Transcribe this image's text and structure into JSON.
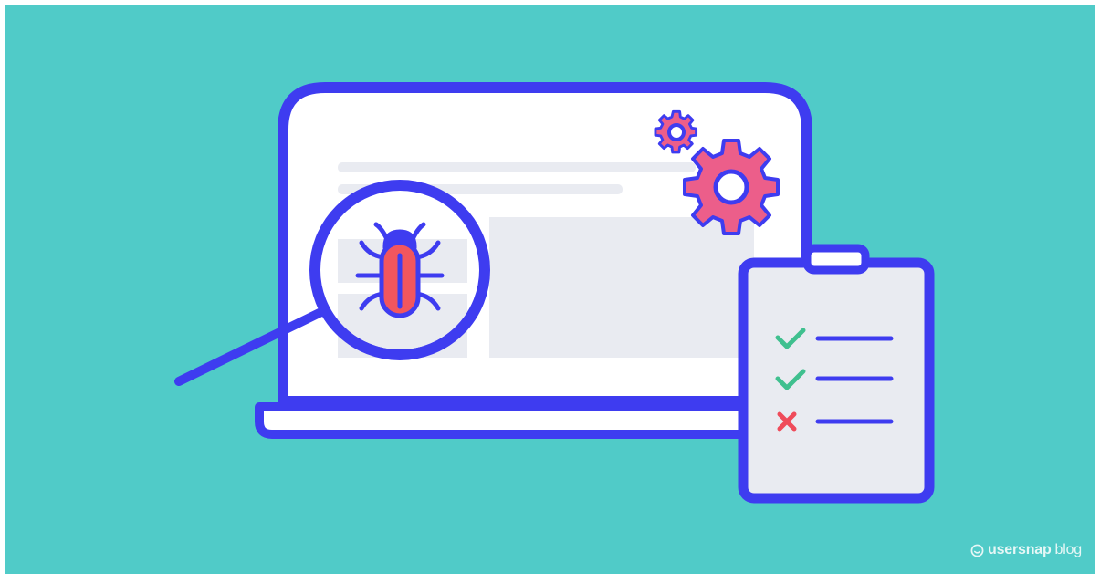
{
  "illustration": {
    "subject": "bug-hunting-laptop-scene",
    "icons": [
      "bug-icon",
      "magnifier-icon",
      "gear-icon",
      "gear-icon",
      "clipboard-icon",
      "check-icon",
      "check-icon",
      "cross-icon"
    ],
    "checklist": [
      {
        "status": "pass"
      },
      {
        "status": "pass"
      },
      {
        "status": "fail"
      }
    ]
  },
  "brand": {
    "name": "usersnap",
    "suffix": "blog",
    "icon": "smile-icon"
  },
  "colors": {
    "background": "#50CBC8",
    "outline": "#3E3CF0",
    "screen": "#FFFFFF",
    "panel": "#E9EBF1",
    "bug": "#F2565E",
    "gear": "#EC5E8A",
    "check": "#3FC08F",
    "cross": "#EF4B5A",
    "brand_text": "#E6F7F6"
  }
}
